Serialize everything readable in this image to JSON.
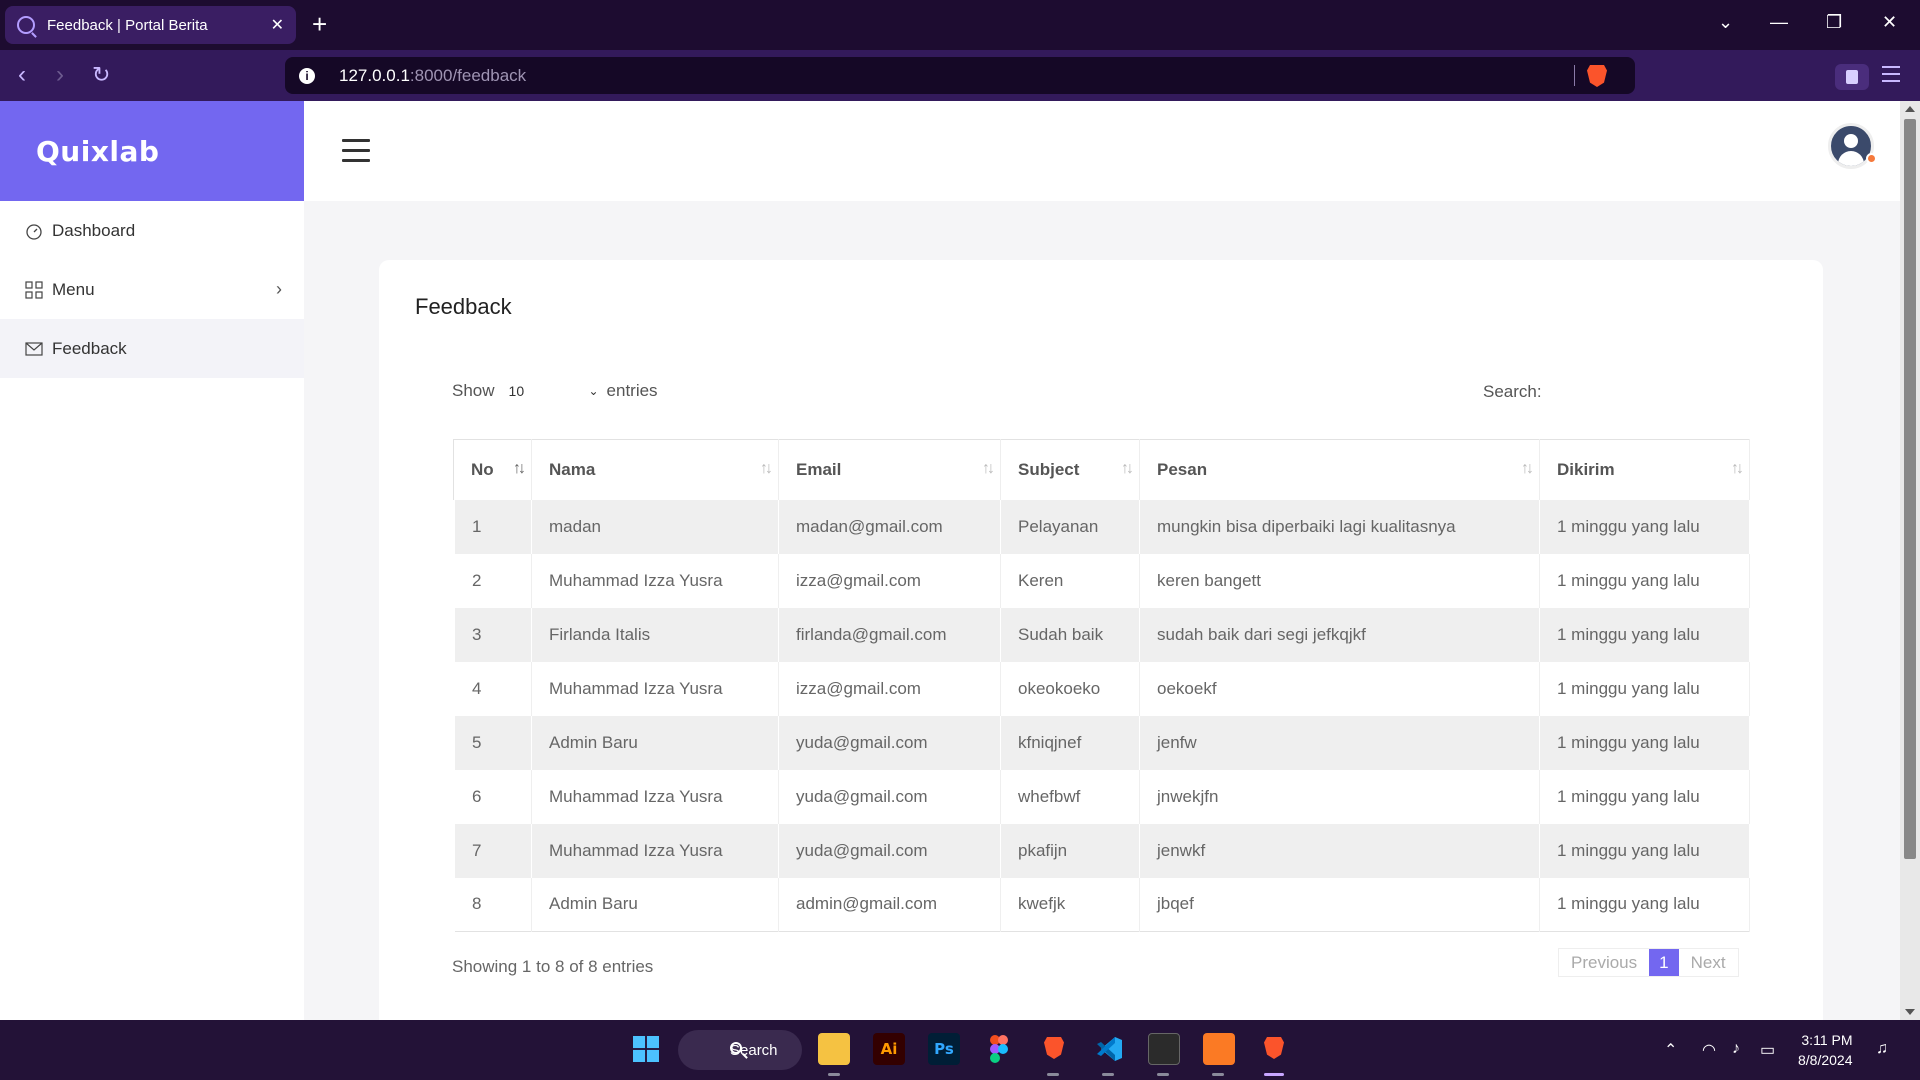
{
  "browser": {
    "tab_title": "Feedback | Portal Berita",
    "close_label": "✕",
    "new_tab_label": "+",
    "url_host": "127.0.0.1",
    "url_path": ":8000/feedback"
  },
  "sidebar": {
    "logo": "Quixlab",
    "items": [
      {
        "label": "Dashboard"
      },
      {
        "label": "Menu"
      },
      {
        "label": "Feedback"
      }
    ]
  },
  "page": {
    "title": "Feedback",
    "show_label": "Show",
    "entries_value": "10",
    "entries_label": "entries",
    "search_label": "Search:"
  },
  "table": {
    "headers": [
      "No",
      "Nama",
      "Email",
      "Subject",
      "Pesan",
      "Dikirim"
    ],
    "rows": [
      [
        "1",
        "madan",
        "madan@gmail.com",
        "Pelayanan",
        "mungkin bisa diperbaiki lagi kualitasnya",
        "1 minggu yang lalu"
      ],
      [
        "2",
        "Muhammad Izza Yusra",
        "izza@gmail.com",
        "Keren",
        "keren bangett",
        "1 minggu yang lalu"
      ],
      [
        "3",
        "Firlanda Italis",
        "firlanda@gmail.com",
        "Sudah baik",
        "sudah baik dari segi jefkqjkf",
        "1 minggu yang lalu"
      ],
      [
        "4",
        "Muhammad Izza Yusra",
        "izza@gmail.com",
        "okeokoeko",
        "oekoekf",
        "1 minggu yang lalu"
      ],
      [
        "5",
        "Admin Baru",
        "yuda@gmail.com",
        "kfniqjnef",
        "jenfw",
        "1 minggu yang lalu"
      ],
      [
        "6",
        "Muhammad Izza Yusra",
        "yuda@gmail.com",
        "whefbwf",
        "jnwekjfn",
        "1 minggu yang lalu"
      ],
      [
        "7",
        "Muhammad Izza Yusra",
        "yuda@gmail.com",
        "pkafijn",
        "jenwkf",
        "1 minggu yang lalu"
      ],
      [
        "8",
        "Admin Baru",
        "admin@gmail.com",
        "kwefjk",
        "jbqef",
        "1 minggu yang lalu"
      ]
    ],
    "info": "Showing 1 to 8 of 8 entries",
    "pager": {
      "previous": "Previous",
      "current": "1",
      "next": "Next"
    }
  },
  "taskbar": {
    "search_label": "Search",
    "ai_label": "Ai",
    "ps_label": "Ps",
    "time": "3:11 PM",
    "date": "8/8/2024"
  },
  "colors": {
    "accent": "#7367f0",
    "browser_bg": "#1d0c30"
  }
}
